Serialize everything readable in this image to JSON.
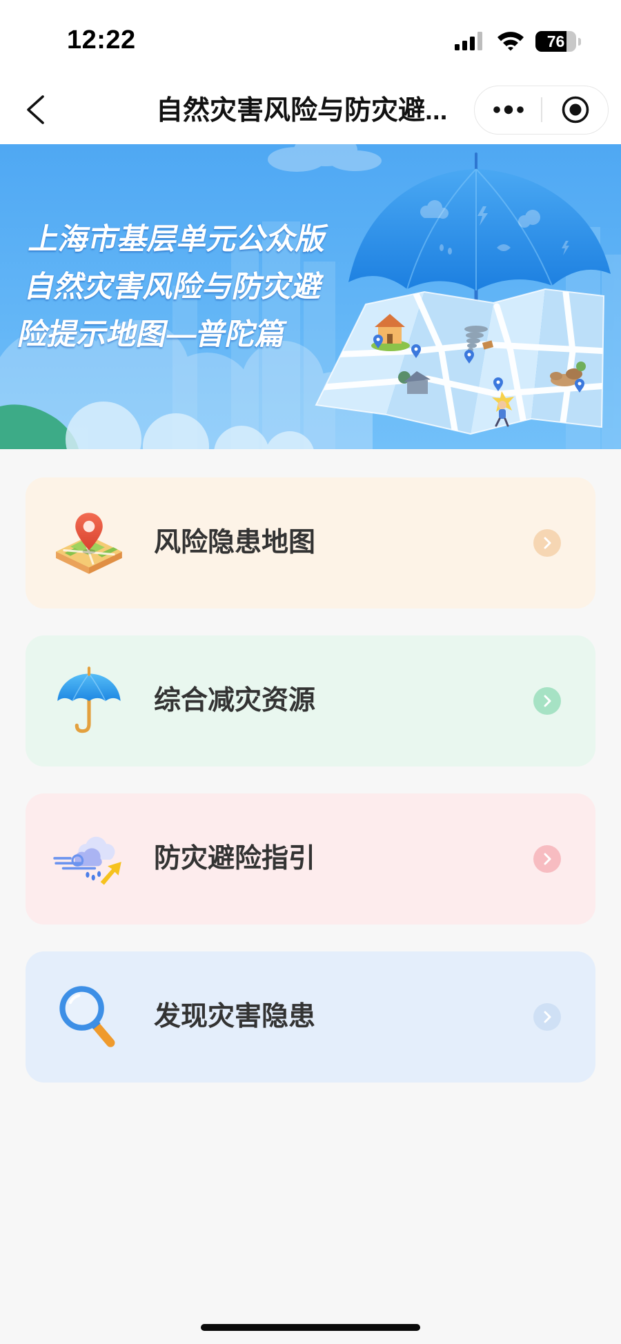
{
  "status_bar": {
    "time": "12:22",
    "battery_level": "76",
    "icons": [
      "signal-icon",
      "wifi-icon",
      "battery-icon"
    ]
  },
  "nav": {
    "title": "自然灾害风险与防灾避...",
    "back_icon": "chevron-left-icon",
    "more_icon": "more-dots-icon",
    "exit_icon": "target-icon"
  },
  "banner": {
    "lines": [
      "上海市基层单元公众版",
      "自然灾害风险与防灾避",
      "险提示地图—普陀篇"
    ],
    "illustration": "umbrella-map-illustration"
  },
  "menu": {
    "items": [
      {
        "label": "风险隐患地图",
        "icon": "map-pin-icon",
        "background": "#fdf3e7",
        "arrow_color": "#f6d6b3"
      },
      {
        "label": "综合减灾资源",
        "icon": "umbrella-icon",
        "background": "#e9f7ef",
        "arrow_color": "#a6e2c4"
      },
      {
        "label": "防灾避险指引",
        "icon": "weather-warning-icon",
        "background": "#fdeced",
        "arrow_color": "#f7bcc1"
      },
      {
        "label": "发现灾害隐患",
        "icon": "magnifier-icon",
        "background": "#e4eefb",
        "arrow_color": "#cfe0f5"
      }
    ]
  },
  "colors": {
    "page_background": "#f7f7f7",
    "label_text": "#333333",
    "banner_sky": "#5cb2f5"
  }
}
